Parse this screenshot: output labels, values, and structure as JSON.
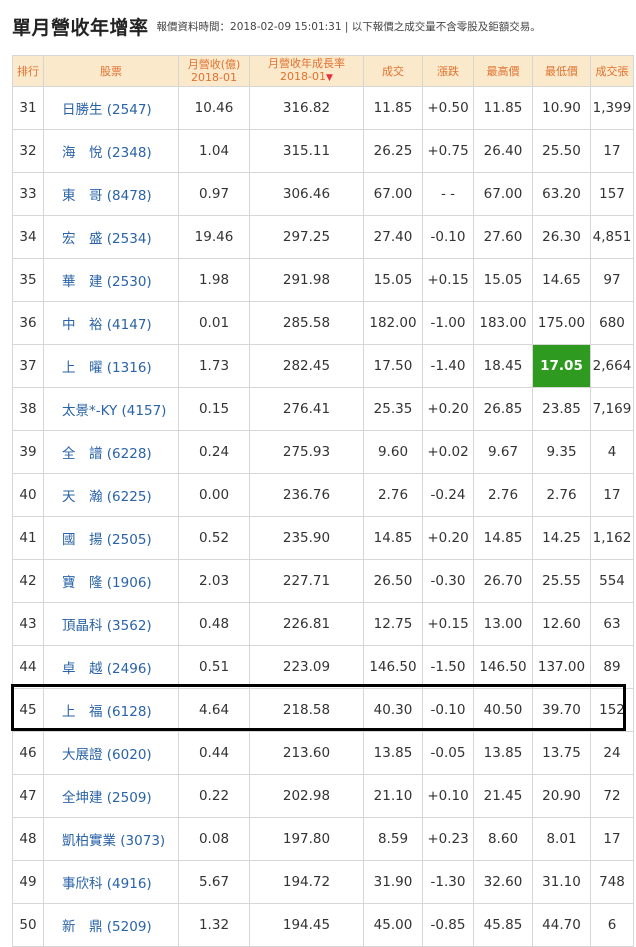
{
  "header": {
    "title": "單月營收年增率",
    "note": "報價資料時間：2018-02-09 15:01:31 | 以下報價之成交量不含零股及鉅額交易。"
  },
  "table": {
    "columns": [
      {
        "l1": "排行",
        "l2": ""
      },
      {
        "l1": "股票",
        "l2": ""
      },
      {
        "l1": "月營收(億)",
        "l2": "2018-01"
      },
      {
        "l1": "月營收年成長率",
        "l2": "2018-01"
      },
      {
        "l1": "成交",
        "l2": ""
      },
      {
        "l1": "漲跌",
        "l2": ""
      },
      {
        "l1": "最高價",
        "l2": ""
      },
      {
        "l1": "最低價",
        "l2": ""
      },
      {
        "l1": "成交張",
        "l2": ""
      }
    ],
    "sort_arrow": "▼",
    "rows": [
      {
        "rank": "31",
        "stock": "日勝生 (2547)",
        "rev": "10.46",
        "growth": "316.82",
        "close": "11.85",
        "chg": "+0.50",
        "high": "11.85",
        "low": "10.90",
        "vol": "1,399",
        "cc": "up",
        "chc": "up",
        "hc": "up",
        "lc": "down"
      },
      {
        "rank": "32",
        "stock": "海　悅 (2348)",
        "rev": "1.04",
        "growth": "315.11",
        "close": "26.25",
        "chg": "+0.75",
        "high": "26.40",
        "low": "25.50",
        "vol": "17",
        "cc": "up",
        "chc": "up",
        "hc": "up",
        "lc": "flat"
      },
      {
        "rank": "33",
        "stock": "東　哥 (8478)",
        "rev": "0.97",
        "growth": "306.46",
        "close": "67.00",
        "chg": "- -",
        "high": "67.00",
        "low": "63.20",
        "vol": "157",
        "cc": "flat",
        "chc": "flat",
        "hc": "flat",
        "lc": "down"
      },
      {
        "rank": "34",
        "stock": "宏　盛 (2534)",
        "rev": "19.46",
        "growth": "297.25",
        "close": "27.40",
        "chg": "-0.10",
        "high": "27.60",
        "low": "26.30",
        "vol": "4,851",
        "cc": "down",
        "chc": "down",
        "hc": "up",
        "lc": "down"
      },
      {
        "rank": "35",
        "stock": "華　建 (2530)",
        "rev": "1.98",
        "growth": "291.98",
        "close": "15.05",
        "chg": "+0.15",
        "high": "15.05",
        "low": "14.65",
        "vol": "97",
        "cc": "up",
        "chc": "up",
        "hc": "up",
        "lc": "down"
      },
      {
        "rank": "36",
        "stock": "中　裕 (4147)",
        "rev": "0.01",
        "growth": "285.58",
        "close": "182.00",
        "chg": "-1.00",
        "high": "183.00",
        "low": "175.00",
        "vol": "680",
        "cc": "down",
        "chc": "down",
        "hc": "flat",
        "lc": "down"
      },
      {
        "rank": "37",
        "stock": "上　曜 (1316)",
        "rev": "1.73",
        "growth": "282.45",
        "close": "17.50",
        "chg": "-1.40",
        "high": "18.45",
        "low": "17.05",
        "vol": "2,664",
        "cc": "down",
        "chc": "down",
        "hc": "down",
        "lc": "hl"
      },
      {
        "rank": "38",
        "stock": "太景*-KY (4157)",
        "rev": "0.15",
        "growth": "276.41",
        "close": "25.35",
        "chg": "+0.20",
        "high": "26.85",
        "low": "23.85",
        "vol": "7,169",
        "cc": "up",
        "chc": "up",
        "hc": "up",
        "lc": "down"
      },
      {
        "rank": "39",
        "stock": "全　譜 (6228)",
        "rev": "0.24",
        "growth": "275.93",
        "close": "9.60",
        "chg": "+0.02",
        "high": "9.67",
        "low": "9.35",
        "vol": "4",
        "cc": "up",
        "chc": "up",
        "hc": "up",
        "lc": "down"
      },
      {
        "rank": "40",
        "stock": "天　瀚 (6225)",
        "rev": "0.00",
        "growth": "236.76",
        "close": "2.76",
        "chg": "-0.24",
        "high": "2.76",
        "low": "2.76",
        "vol": "17",
        "cc": "down",
        "chc": "down",
        "hc": "down",
        "lc": "down"
      },
      {
        "rank": "41",
        "stock": "國　揚 (2505)",
        "rev": "0.52",
        "growth": "235.90",
        "close": "14.85",
        "chg": "+0.20",
        "high": "14.85",
        "low": "14.25",
        "vol": "1,162",
        "cc": "up",
        "chc": "up",
        "hc": "up",
        "lc": "down"
      },
      {
        "rank": "42",
        "stock": "寶　隆 (1906)",
        "rev": "2.03",
        "growth": "227.71",
        "close": "26.50",
        "chg": "-0.30",
        "high": "26.70",
        "low": "25.55",
        "vol": "554",
        "cc": "down",
        "chc": "down",
        "hc": "down",
        "lc": "down"
      },
      {
        "rank": "43",
        "stock": "頂晶科 (3562)",
        "rev": "0.48",
        "growth": "226.81",
        "close": "12.75",
        "chg": "+0.15",
        "high": "13.00",
        "low": "12.60",
        "vol": "63",
        "cc": "up",
        "chc": "up",
        "hc": "up",
        "lc": "flat"
      },
      {
        "rank": "44",
        "stock": "卓　越 (2496)",
        "rev": "0.51",
        "growth": "223.09",
        "close": "146.50",
        "chg": "-1.50",
        "high": "146.50",
        "low": "137.00",
        "vol": "89",
        "cc": "down",
        "chc": "down",
        "hc": "down",
        "lc": "down"
      },
      {
        "rank": "45",
        "stock": "上　福 (6128)",
        "rev": "4.64",
        "growth": "218.58",
        "close": "40.30",
        "chg": "-0.10",
        "high": "40.50",
        "low": "39.70",
        "vol": "152",
        "cc": "down",
        "chc": "down",
        "hc": "up",
        "lc": "down"
      },
      {
        "rank": "46",
        "stock": "大展證 (6020)",
        "rev": "0.44",
        "growth": "213.60",
        "close": "13.85",
        "chg": "-0.05",
        "high": "13.85",
        "low": "13.75",
        "vol": "24",
        "cc": "down",
        "chc": "down",
        "hc": "down",
        "lc": "down"
      },
      {
        "rank": "47",
        "stock": "全坤建 (2509)",
        "rev": "0.22",
        "growth": "202.98",
        "close": "21.10",
        "chg": "+0.10",
        "high": "21.45",
        "low": "20.90",
        "vol": "72",
        "cc": "up",
        "chc": "up",
        "hc": "up",
        "lc": "down"
      },
      {
        "rank": "48",
        "stock": "凱柏實業 (3073)",
        "rev": "0.08",
        "growth": "197.80",
        "close": "8.59",
        "chg": "+0.23",
        "high": "8.60",
        "low": "8.01",
        "vol": "17",
        "cc": "up",
        "chc": "up",
        "hc": "up",
        "lc": "down"
      },
      {
        "rank": "49",
        "stock": "事欣科 (4916)",
        "rev": "5.67",
        "growth": "194.72",
        "close": "31.90",
        "chg": "-1.30",
        "high": "32.60",
        "low": "31.10",
        "vol": "748",
        "cc": "down",
        "chc": "down",
        "hc": "down",
        "lc": "down"
      },
      {
        "rank": "50",
        "stock": "新　鼎 (5209)",
        "rev": "1.32",
        "growth": "194.45",
        "close": "45.00",
        "chg": "-0.85",
        "high": "45.85",
        "low": "44.70",
        "vol": "6",
        "cc": "down",
        "chc": "down",
        "hc": "flat",
        "lc": "down"
      }
    ]
  },
  "colors": {
    "up": "#e8303f",
    "down": "#1f9a1f",
    "header_bg": "#fbe9cc",
    "header_text": "#e0712e",
    "stock_link": "#2a63a8",
    "highlight_bg": "#2e9a1f"
  }
}
